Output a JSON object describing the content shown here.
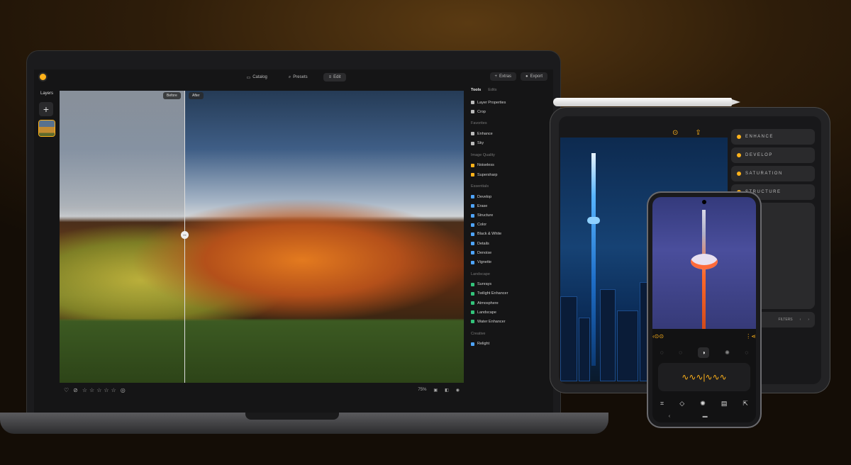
{
  "laptop": {
    "topbar": {
      "catalog": "Catalog",
      "presets": "Presets",
      "edit": "Edit",
      "extras": "Extras",
      "export": "Export"
    },
    "layers_title": "Layers",
    "add_symbol": "+",
    "photo": {
      "before": "Before",
      "after": "After"
    },
    "bottom": {
      "zoom": "75%"
    },
    "panel": {
      "tab_tools": "Tools",
      "tab_edits": "Edits",
      "top_items": [
        "Layer Properties",
        "Crop"
      ],
      "sections": [
        {
          "title": "Favorites",
          "items": [
            "Enhance",
            "Sky"
          ]
        },
        {
          "title": "Image Quality",
          "items": [
            "Noiseless",
            "Supersharp"
          ]
        },
        {
          "title": "Essentials",
          "items": [
            "Develop",
            "Erase",
            "Structure",
            "Color",
            "Black & White",
            "Details",
            "Denoise",
            "Vignette"
          ]
        },
        {
          "title": "Landscape",
          "items": [
            "Sunrays",
            "Twilight Enhancer",
            "Atmosphere",
            "Landscape",
            "Water Enhancer"
          ]
        },
        {
          "title": "Creative",
          "items": [
            "Relight"
          ]
        }
      ]
    }
  },
  "tablet": {
    "options": [
      "ENHANCE",
      "DEVELOP",
      "SATURATION",
      "STRUCTURE"
    ],
    "bottom_label": "FILTERS"
  }
}
